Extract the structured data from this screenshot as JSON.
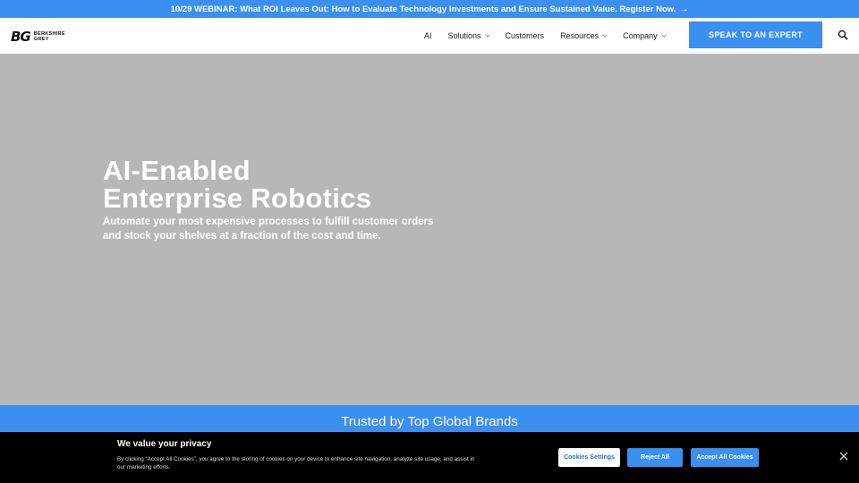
{
  "announcement": {
    "text": "10/29 WEBINAR: What ROI Leaves Out: How to Evaluate Technology Investments and Ensure Sustained Value. Register Now.",
    "arrow": "→"
  },
  "header": {
    "logo": {
      "mark": "BG",
      "line1": "BERKSHIRE",
      "line2": "GREY"
    },
    "nav": [
      {
        "label": "AI",
        "has_dropdown": false
      },
      {
        "label": "Solutions",
        "has_dropdown": true
      },
      {
        "label": "Customers",
        "has_dropdown": false
      },
      {
        "label": "Resources",
        "has_dropdown": true
      },
      {
        "label": "Company",
        "has_dropdown": true
      }
    ],
    "cta_label": "SPEAK TO AN EXPERT",
    "search_icon": "search-icon"
  },
  "hero": {
    "title_line1": "AI-Enabled",
    "title_line2": "Enterprise Robotics",
    "subtitle_line1": "Automate your most expensive processes to fulfill customer orders",
    "subtitle_line2": "and stock your shelves at a fraction of the cost and time."
  },
  "trusted": {
    "text": "Trusted by Top Global Brands"
  },
  "cookie_banner": {
    "title": "We value your privacy",
    "text": "By clicking “Accept All Cookies”, you agree to the storing of cookies on your device to enhance site navigation, analyze site usage, and assist in our marketing efforts.",
    "settings_label": "Cookies Settings",
    "reject_label": "Reject All",
    "accept_label": "Accept All Cookies"
  },
  "colors": {
    "accent": "#3a8ff0",
    "hero_bg": "#b7b7b7",
    "banner_bg": "#000000"
  }
}
